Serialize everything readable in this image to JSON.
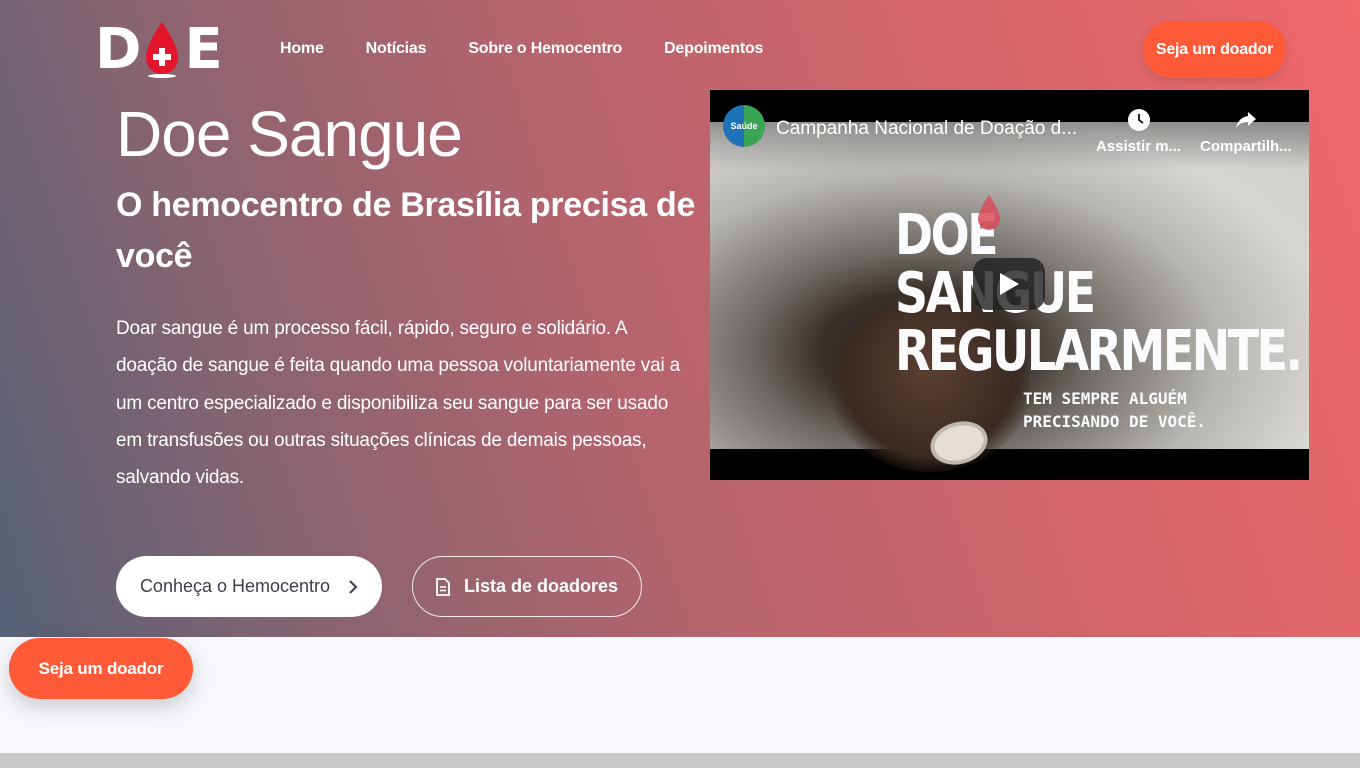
{
  "brand": {
    "logo_left": "D",
    "logo_right": "E"
  },
  "nav": {
    "items": [
      "Home",
      "Notícias",
      "Sobre o Hemocentro",
      "Depoimentos"
    ]
  },
  "header_cta": "Seja um doador",
  "hero": {
    "title": "Doe Sangue",
    "subtitle": "O hemocentro de Brasília precisa de você",
    "description": "Doar sangue é um processo fácil, rápido, seguro e solidário. A doação de sangue é feita quando uma pessoa voluntariamente vai a um centro especializado e disponibiliza seu sangue para ser usado em transfusões ou outras situações clínicas de demais pessoas, salvando vidas.",
    "primary_button": "Conheça o Hemocentro",
    "secondary_button": "Lista de doadores"
  },
  "video": {
    "channel_badge": "Saúde",
    "title": "Campanha Nacional de Doação d...",
    "watch_later": "Assistir m...",
    "share": "Compartilh...",
    "overlay_line1": "DOE",
    "overlay_line2": "SANGUE",
    "overlay_line3": "REGULARMENTE.",
    "overlay_small1": "TEM SEMPRE ALGUÉM",
    "overlay_small2": "PRECISANDO DE VOCÊ."
  },
  "floating_cta": "Seja um doador",
  "colors": {
    "accent": "#fe5a37",
    "gradient_start": "#566276",
    "gradient_end": "#f0696b"
  },
  "icons": [
    "blood-drop-cross-icon",
    "chevron-right-icon",
    "document-icon",
    "clock-icon",
    "share-icon",
    "play-icon"
  ]
}
